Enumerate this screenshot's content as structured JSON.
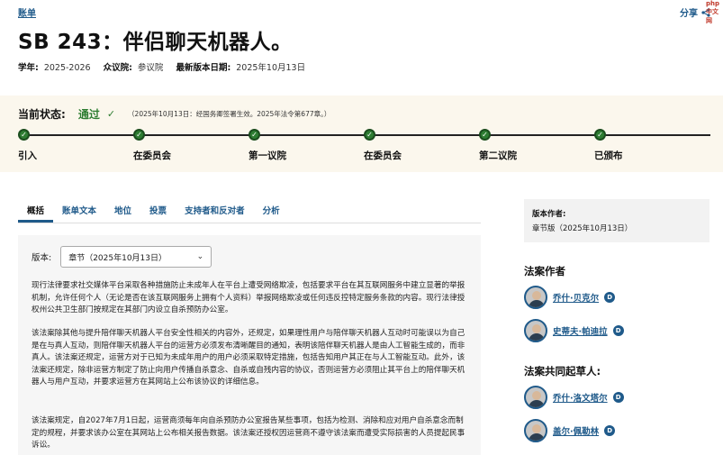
{
  "breadcrumb": "账单",
  "share_label": "分享",
  "watermark": "php中文网",
  "title": "SB 243：伴侣聊天机器人。",
  "meta": {
    "year_label": "学年:",
    "year_value": "2025-2026",
    "house_label": "众议院:",
    "house_value": "参议院",
    "date_label": "最新版本日期:",
    "date_value": "2025年10月13日"
  },
  "status": {
    "label": "当前状态:",
    "value": "通过",
    "note": "（2025年10月13日：经国务卿签署生效。2025年法令第677章。）",
    "steps": [
      "引入",
      "在委员会",
      "第一议院",
      "在委员会",
      "第二议院",
      "已颁布"
    ]
  },
  "tabs": [
    "概括",
    "账单文本",
    "地位",
    "投票",
    "支持者和反对者",
    "分析"
  ],
  "version": {
    "label": "版本:",
    "selected": "章节（2025年10月13日）"
  },
  "paragraphs": [
    "现行法律要求社交媒体平台采取各种措施防止未成年人在平台上遭受网络欺凌，包括要求平台在其互联网服务中建立显著的举报机制，允许任何个人（无论是否在该互联网服务上拥有个人资料）举报网络欺凌或任何违反控特定服务条款的内容。现行法律授权州公共卫生部门按规定在其部门内设立自杀预防办公室。",
    "该法案除其他与提升陪伴聊天机器人平台安全性相关的内容外，还规定，如果理性用户与陪伴聊天机器人互动时可能误以为自己是在与真人互动，则陪伴聊天机器人平台的运营方必须发布清晰醒目的通知，表明该陪伴聊天机器人是由人工智能生成的，而非真人。该法案还规定，运营方对于已知为未成年用户的用户必须采取特定措施，包括告知用户其正在与人工智能互动。此外，该法案还规定，除非运营方制定了防止向用户传播自杀意念、自杀或自残内容的协议，否则运营方必须阻止其平台上的陪伴聊天机器人与用户互动，并要求运营方在其网站上公布该协议的详细信息。",
    "该法案规定，自2027年7月1日起，运营商须每年向自杀预防办公室报告某些事项，包括为检测、消除和应对用户自杀意念而制定的规程，并要求该办公室在其网站上公布相关报告数据。该法案还授权因运营商不遵守该法案而遭受实际损害的人员提起民事诉讼。"
  ],
  "sidebar": {
    "author_box_heading": "版本作者:",
    "author_box_value": "章节版（2025年10月13日）",
    "authors_heading": "法案作者",
    "authors": [
      {
        "name": "乔什·贝克尔",
        "party": "D"
      },
      {
        "name": "史蒂夫·帕迪拉",
        "party": "D"
      }
    ],
    "coauthors_heading": "法案共同起草人:",
    "coauthors": [
      {
        "name": "乔什·洛文塔尔",
        "party": "D"
      },
      {
        "name": "盖尔·佩勒林",
        "party": "D"
      }
    ]
  },
  "colors": {
    "accent": "#1f5a8a",
    "status_green": "#2e7d32",
    "status_band": "#fbf7ed"
  }
}
